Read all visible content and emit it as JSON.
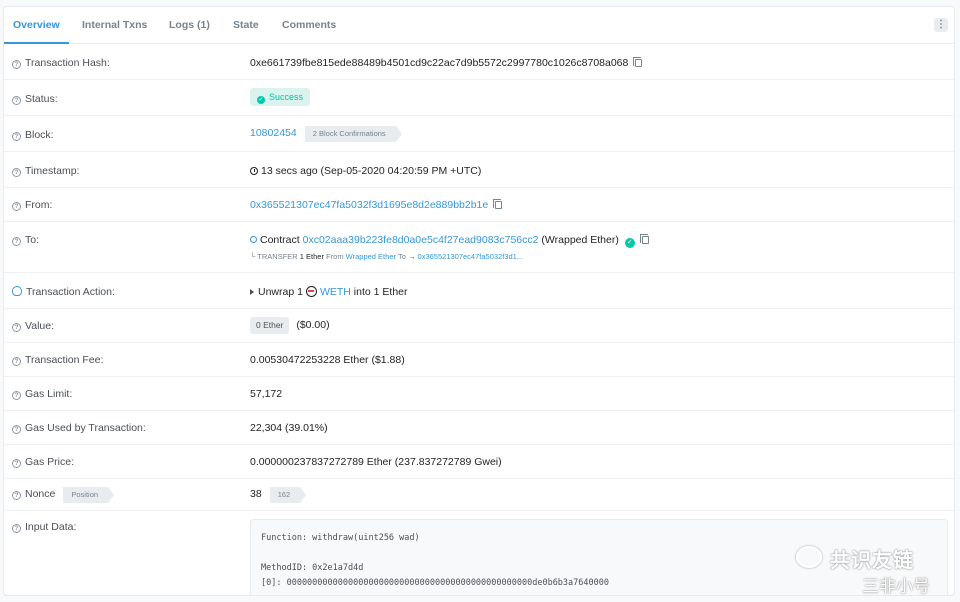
{
  "tabs": [
    "Overview",
    "Internal Txns",
    "Logs (1)",
    "State",
    "Comments"
  ],
  "menu_icon": "⋮",
  "fields": {
    "tx_hash": {
      "label": "Transaction Hash:",
      "value": "0xe661739fbe815ede88489b4501cd9c22ac7d9b5572c2997780c1026c8708a068"
    },
    "status": {
      "label": "Status:",
      "value": "Success"
    },
    "block": {
      "label": "Block:",
      "value": "10802454",
      "badge": "2 Block Confirmations"
    },
    "timestamp": {
      "label": "Timestamp:",
      "value": "13 secs ago (Sep-05-2020 04:20:59 PM +UTC)"
    },
    "from": {
      "label": "From:",
      "value": "0x365521307ec47fa5032f3d1695e8d2e889bb2b1e"
    },
    "to": {
      "label": "To:",
      "prefix": "Contract",
      "value": "0xc02aaa39b223fe8d0a0e5c4f27ead9083c756cc2",
      "name": "(Wrapped Ether)",
      "transfer": {
        "arrow": "└",
        "kind": "TRANSFER",
        "amount": "1 Ether",
        "from_label": "From",
        "from_value": "Wrapped Ether",
        "to_label": "To",
        "to_arrow": "→",
        "to_value": "0x365521307ec47fa5032f3d1..."
      }
    },
    "action": {
      "label": "Transaction Action:",
      "verb": "Unwrap",
      "amount": "1",
      "token": "WETH",
      "into": "into",
      "result": "1 Ether"
    },
    "value": {
      "label": "Value:",
      "badge": "0 Ether",
      "usd": "($0.00)"
    },
    "fee": {
      "label": "Transaction Fee:",
      "value": "0.00530472253228 Ether ($1.88)"
    },
    "gas_limit": {
      "label": "Gas Limit:",
      "value": "57,172"
    },
    "gas_used": {
      "label": "Gas Used by Transaction:",
      "value": "22,304 (39.01%)"
    },
    "gas_price": {
      "label": "Gas Price:",
      "value": "0.000000237837272789 Ether (237.837272789 Gwei)"
    },
    "nonce": {
      "label": "Nonce",
      "tag": "Position",
      "value": "38",
      "position": "162"
    },
    "input": {
      "label": "Input Data:",
      "function": "Function: withdraw(uint256 wad)",
      "method": "MethodID: 0x2e1a7d4d",
      "param": "[0]:  000000000000000000000000000000000000000000000000de0b6b3a7640000"
    }
  },
  "watermark": {
    "line1": "共识友链",
    "line2": "三非小号"
  },
  "colors": {
    "accent": "#3498db",
    "success": "#00c9a7",
    "text": "#1e2022",
    "muted": "#77838f"
  }
}
